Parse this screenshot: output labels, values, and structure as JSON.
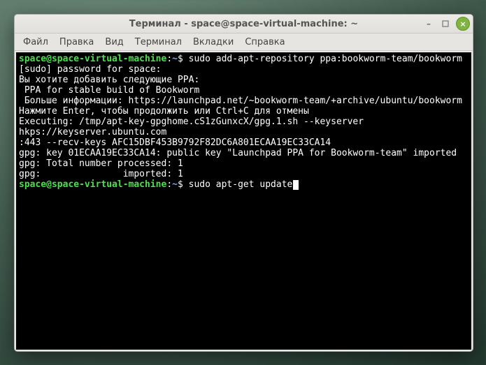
{
  "window": {
    "title": "Терминал - space@space-virtual-machine: ~"
  },
  "window_controls": {
    "minimize": "–",
    "maximize": "□",
    "close": "×"
  },
  "menubar": {
    "items": [
      "Файл",
      "Правка",
      "Вид",
      "Терминал",
      "Вкладки",
      "Справка"
    ]
  },
  "terminal": {
    "prompt_user": "space@space-virtual-machine",
    "prompt_sep": ":",
    "prompt_path": "~",
    "prompt_end": "$ ",
    "cmd1": "sudo add-apt-repository ppa:bookworm-team/bookworm",
    "lines": [
      "[sudo] password for space: ",
      "Вы хотите добавить следующие PPA:",
      " PPA for stable build of Bookworm",
      " Больше информации: https://launchpad.net/~bookworm-team/+archive/ubuntu/bookworm",
      "Нажмите Enter, чтобы продолжить или Ctrl+C для отмены",
      "",
      "Executing: /tmp/apt-key-gpghome.cS1zGunxcX/gpg.1.sh --keyserver hkps://keyserver.ubuntu.com:443 --recv-keys AFC15DBF453B9792F82DC6A801ECAA19EC33CA14",
      "gpg: key 01ECAA19EC33CA14: public key \"Launchpad PPA for Bookworm-team\" imported",
      "gpg: Total number processed: 1",
      "gpg:               imported: 1"
    ],
    "cmd2": "sudo apt-get update"
  }
}
